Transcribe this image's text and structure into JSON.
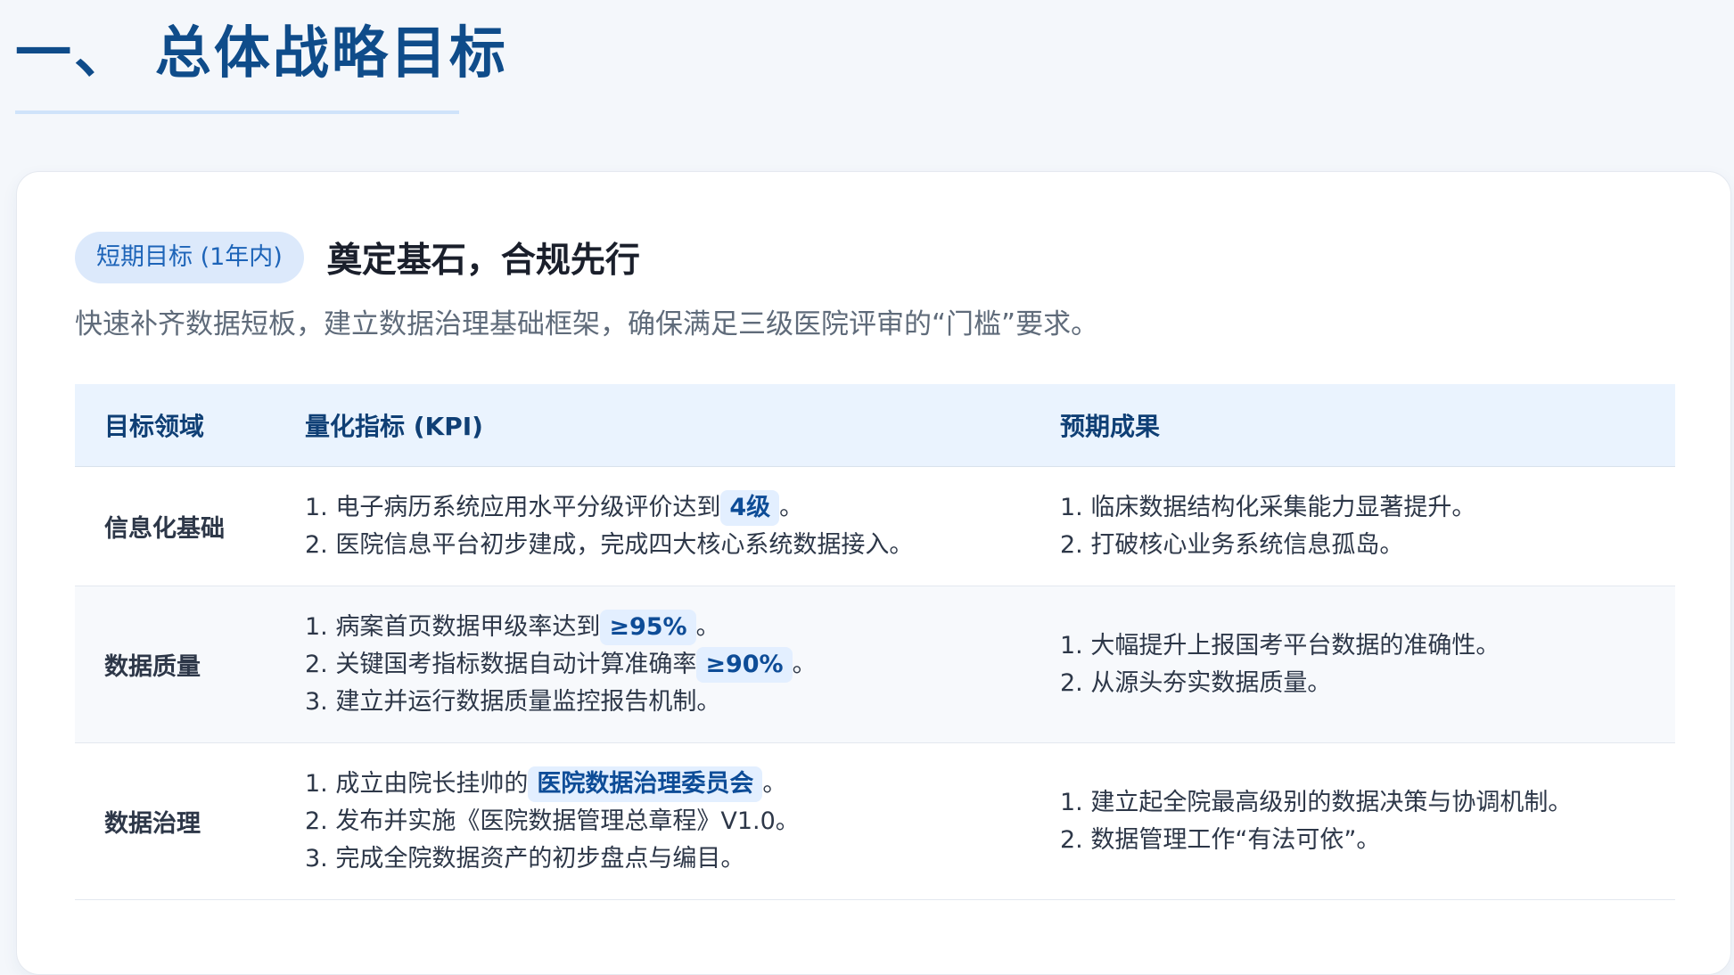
{
  "section": {
    "title": "一、 总体战略目标"
  },
  "goal": {
    "badge": "短期目标 (1年内)",
    "title": "奠定基石，合规先行",
    "description": "快速补齐数据短板，建立数据治理基础框架，确保满足三级医院评审的“门槛”要求。"
  },
  "table": {
    "headers": [
      "目标领域",
      "量化指标 (KPI)",
      "预期成果"
    ],
    "rows": [
      {
        "area": "信息化基础",
        "kpis": [
          {
            "prefix": "1. 电子病历系统应用水平分级评价达到",
            "highlight": "4级",
            "suffix": "。"
          },
          {
            "prefix": "2. 医院信息平台初步建成，完成四大核心系统数据接入。",
            "highlight": "",
            "suffix": ""
          }
        ],
        "outcomes": [
          "1. 临床数据结构化采集能力显著提升。",
          "2. 打破核心业务系统信息孤岛。"
        ]
      },
      {
        "area": "数据质量",
        "kpis": [
          {
            "prefix": "1. 病案首页数据甲级率达到",
            "highlight": "≥95%",
            "suffix": "。"
          },
          {
            "prefix": "2. 关键国考指标数据自动计算准确率",
            "highlight": "≥90%",
            "suffix": "。"
          },
          {
            "prefix": "3. 建立并运行数据质量监控报告机制。",
            "highlight": "",
            "suffix": ""
          }
        ],
        "outcomes": [
          "1. 大幅提升上报国考平台数据的准确性。",
          "2. 从源头夯实数据质量。"
        ]
      },
      {
        "area": "数据治理",
        "kpis": [
          {
            "prefix": "1. 成立由院长挂帅的",
            "highlight": "医院数据治理委员会",
            "suffix": "。"
          },
          {
            "prefix": "2. 发布并实施《医院数据管理总章程》V1.0。",
            "highlight": "",
            "suffix": ""
          },
          {
            "prefix": "3. 完成全院数据资产的初步盘点与编目。",
            "highlight": "",
            "suffix": ""
          }
        ],
        "outcomes": [
          "1. 建立起全院最高级别的数据决策与协调机制。",
          "2. 数据管理工作“有法可依”。"
        ]
      }
    ]
  }
}
